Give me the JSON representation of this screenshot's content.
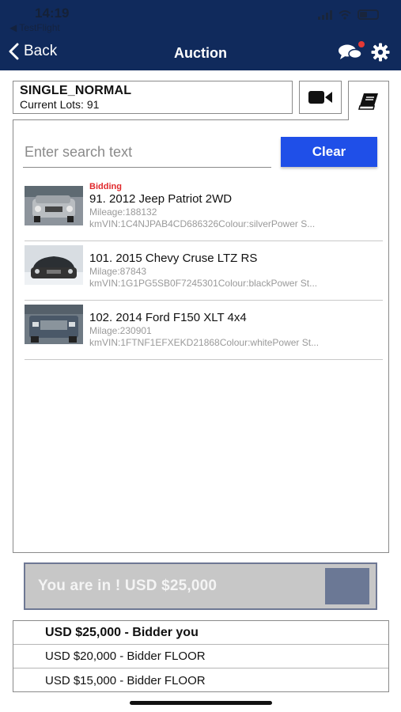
{
  "status_bar": {
    "time": "14:19",
    "back_app": "◀ TestFlight"
  },
  "nav": {
    "back_label": "Back",
    "title": "Auction"
  },
  "session": {
    "name": "SINGLE_NORMAL",
    "lots_label": "Current Lots: 91"
  },
  "search": {
    "placeholder": "Enter search text",
    "value": "",
    "clear_label": "Clear"
  },
  "lots": [
    {
      "status": "Bidding",
      "title": "91. 2012 Jeep Patriot 2WD",
      "meta1": "Mileage:188132",
      "meta2": "kmVIN:1C4NJPAB4CD686326Colour:silverPower S..."
    },
    {
      "status": "",
      "title": "101. 2015 Chevy Cruse LTZ RS",
      "meta1": "Milage:87843",
      "meta2": "kmVIN:1G1PG5SB0F7245301Colour:blackPower St..."
    },
    {
      "status": "",
      "title": "102. 2014 Ford F150 XLT 4x4",
      "meta1": "Milage:230901",
      "meta2": "kmVIN:1FTNF1EFXEKD21868Colour:whitePower St..."
    }
  ],
  "bid_bar": {
    "text": "You are in ! USD $25,000"
  },
  "bid_history": [
    "USD $25,000 - Bidder you",
    "USD $20,000 - Bidder FLOOR",
    "USD $15,000 - Bidder FLOOR"
  ],
  "colors": {
    "header": "#102a5c",
    "accent": "#1f4fe8",
    "bidding": "#e0282b"
  },
  "icons": [
    "chevron-left-icon",
    "chat-bubbles-icon",
    "gear-icon",
    "video-camera-icon",
    "book-icon"
  ]
}
